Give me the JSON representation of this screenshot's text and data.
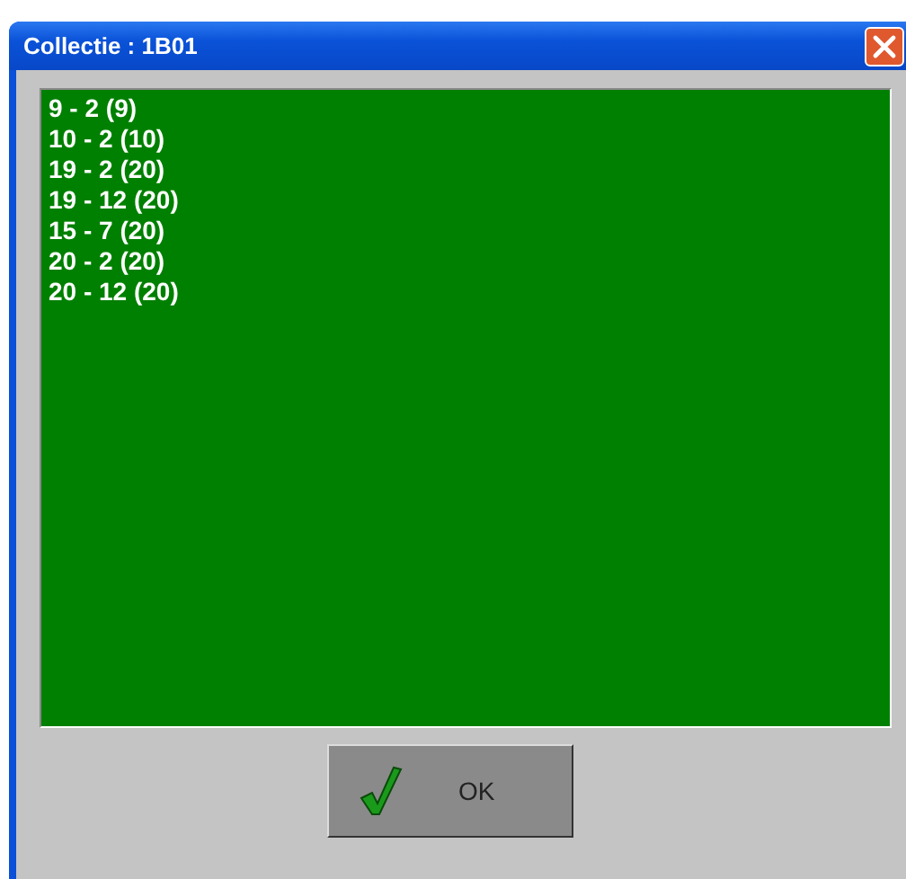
{
  "window": {
    "title": "Collectie : 1B01"
  },
  "items": [
    "9 - 2 (9)",
    "10 - 2 (10)",
    "19 - 2 (20)",
    "19 - 12 (20)",
    "15 - 7 (20)",
    "20 - 2 (20)",
    "20 - 12 (20)"
  ],
  "buttons": [
    "OK"
  ]
}
